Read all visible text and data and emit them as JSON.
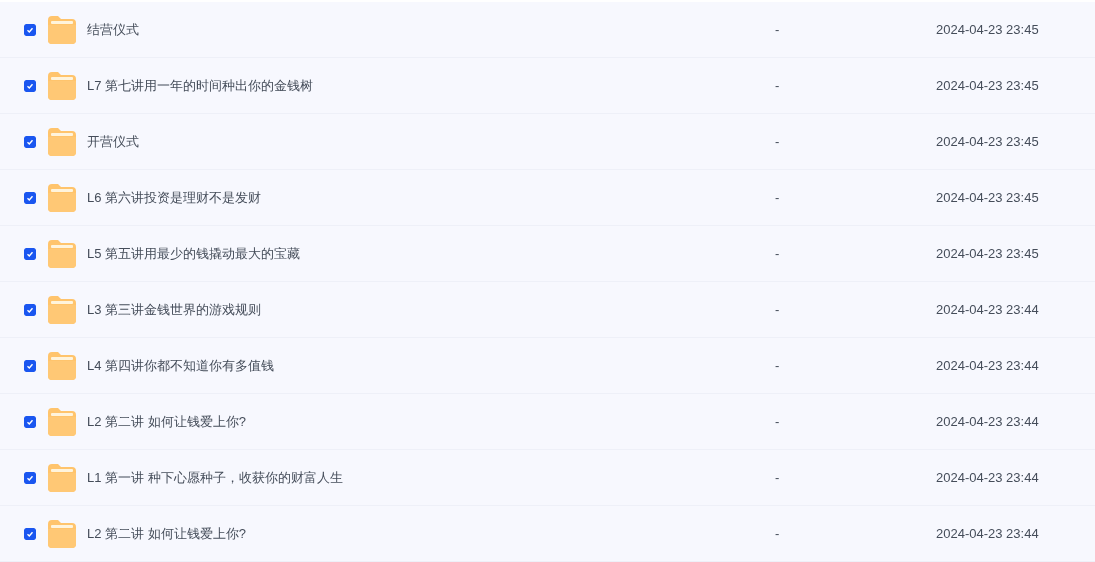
{
  "rows": [
    {
      "name": "结营仪式",
      "checked": true,
      "size": "-",
      "modified": "2024-04-23 23:45"
    },
    {
      "name": "L7 第七讲用一年的时间种出你的金钱树",
      "checked": true,
      "size": "-",
      "modified": "2024-04-23 23:45"
    },
    {
      "name": "开营仪式",
      "checked": true,
      "size": "-",
      "modified": "2024-04-23 23:45"
    },
    {
      "name": "L6 第六讲投资是理财不是发财",
      "checked": true,
      "size": "-",
      "modified": "2024-04-23 23:45"
    },
    {
      "name": "L5 第五讲用最少的钱撬动最大的宝藏",
      "checked": true,
      "size": "-",
      "modified": "2024-04-23 23:45"
    },
    {
      "name": "L3 第三讲金钱世界的游戏规则",
      "checked": true,
      "size": "-",
      "modified": "2024-04-23 23:44"
    },
    {
      "name": "L4 第四讲你都不知道你有多值钱",
      "checked": true,
      "size": "-",
      "modified": "2024-04-23 23:44"
    },
    {
      "name": "L2 第二讲 如何让钱爱上你?",
      "checked": true,
      "size": "-",
      "modified": "2024-04-23 23:44"
    },
    {
      "name": "L1 第一讲 种下心愿种子，收获你的财富人生",
      "checked": true,
      "size": "-",
      "modified": "2024-04-23 23:44"
    },
    {
      "name": "L2 第二讲 如何让钱爱上你?",
      "checked": true,
      "size": "-",
      "modified": "2024-04-23 23:44"
    }
  ]
}
